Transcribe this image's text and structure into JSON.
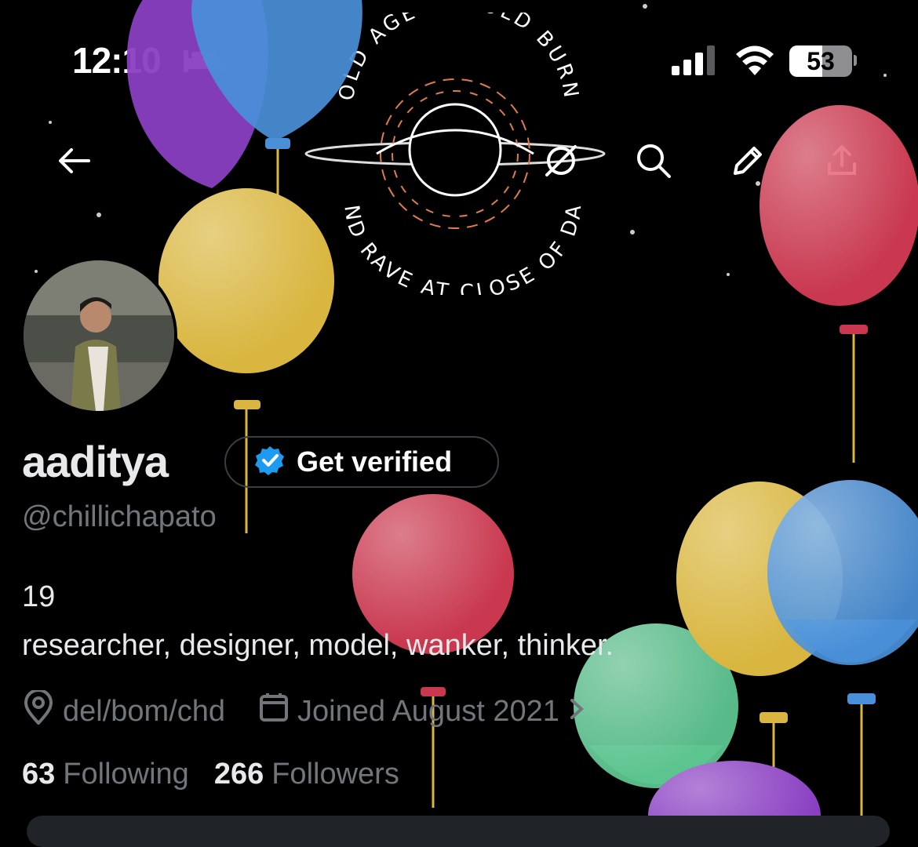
{
  "status_bar": {
    "time": "12:10",
    "sleep_icon": "bed-icon",
    "signal_icon": "cellular-signal-icon",
    "wifi_icon": "wifi-icon",
    "battery_percent": "53",
    "battery_level": 0.53
  },
  "banner": {
    "text_top": "OLD AGE SHOULD BURN",
    "text_bottom": "AND RAVE AT CLOSE OF DAY"
  },
  "nav": {
    "back_icon": "arrow-left-icon",
    "grok_icon": "grok-icon",
    "search_icon": "search-icon",
    "edit_icon": "pencil-icon",
    "share_icon": "share-icon"
  },
  "profile": {
    "display_name": "aaditya",
    "get_verified_label": "Get verified",
    "handle": "@chillichapato",
    "bio_line1": "19",
    "bio_line2": "researcher, designer, model, wanker, thinker.",
    "location": "del/bom/chd",
    "joined": "Joined August 2021",
    "following_count": "63",
    "following_label": "Following",
    "followers_count": "266",
    "followers_label": "Followers"
  },
  "colors": {
    "accent_blue": "#1d9bf0",
    "muted_text": "#71767b",
    "balloon_purple": "#8a3fc2",
    "balloon_blue": "#4a90d9",
    "balloon_yellow": "#d9b63f",
    "balloon_red": "#c9384f",
    "balloon_green": "#5cc48f"
  }
}
